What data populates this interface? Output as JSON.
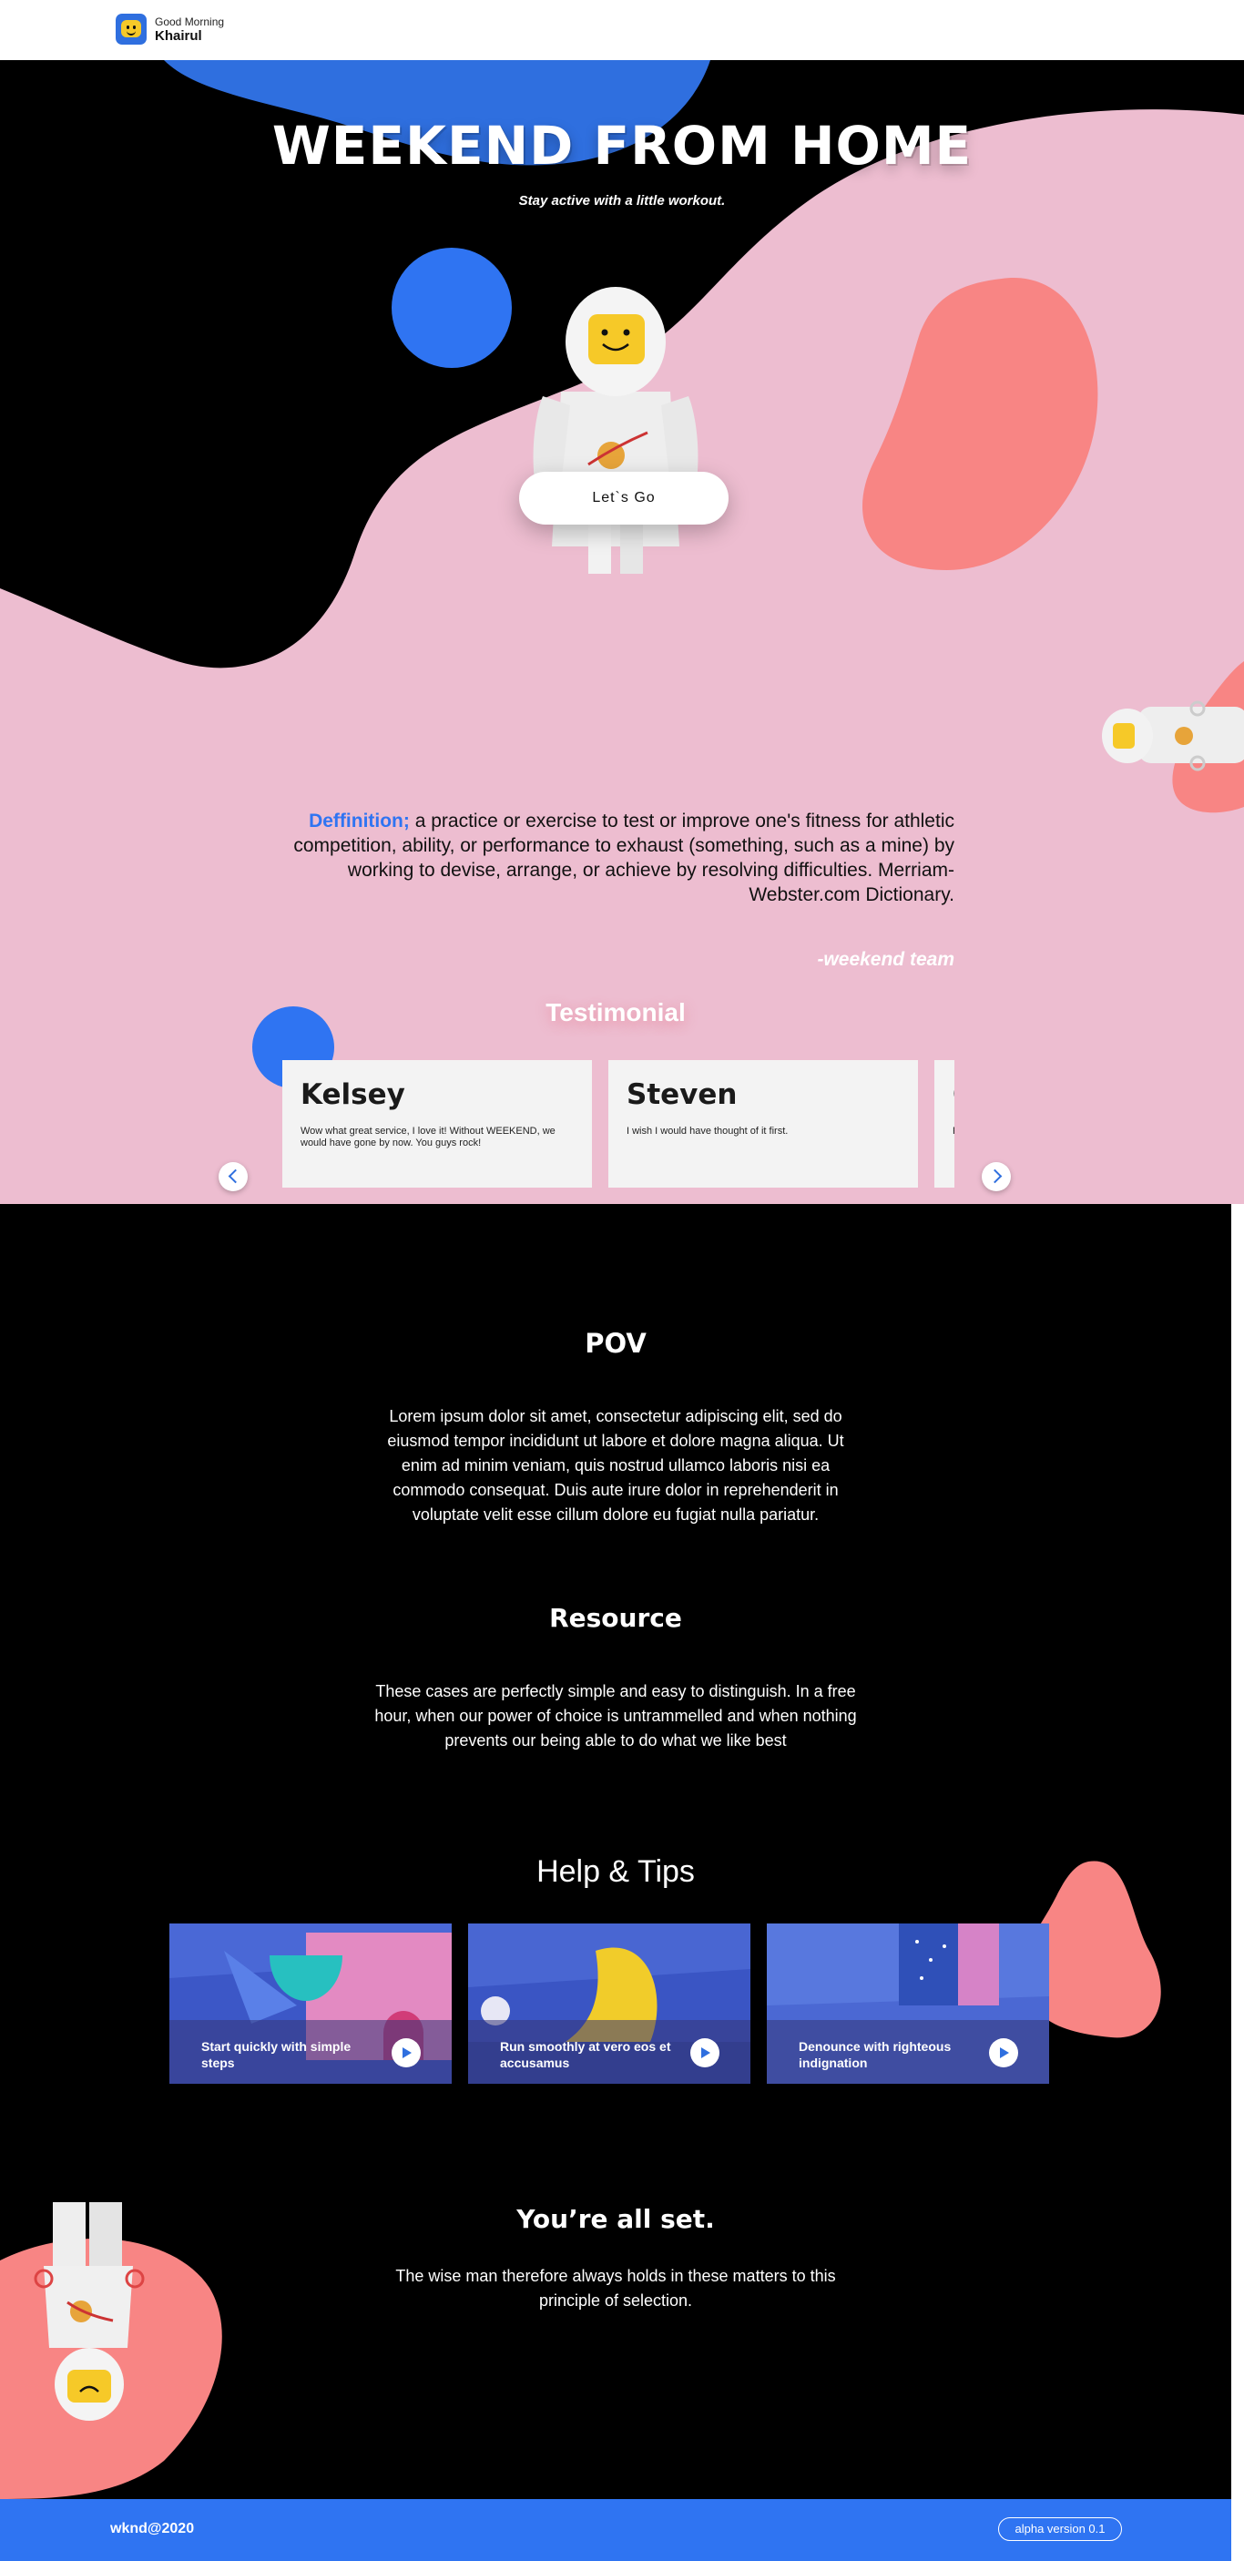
{
  "header": {
    "greeting": "Good Morning",
    "user_name": "Khairul"
  },
  "hero": {
    "title": "WEEKEND FROM HOME",
    "subtitle": "Stay active with a little workout.",
    "cta_label": "Let`s Go"
  },
  "definition": {
    "term": "Deffinition;",
    "body": " a practice or exercise to test or improve one's fitness for athletic competition, ability, or performance to exhaust (something, such as a mine) by working to devise, arrange, or achieve by resolving difficulties. Merriam-Webster.com Dictionary.",
    "signature": "-weekend team"
  },
  "testimonial": {
    "title": "Testimonial",
    "cards": [
      {
        "name": "Kelsey",
        "text": "Wow what great service, I love it! Without WEEKEND, we would have gone by now. You guys rock!"
      },
      {
        "name": "Steven",
        "text": "I wish I would have thought of it first."
      },
      {
        "name": "C",
        "text": "P"
      }
    ]
  },
  "pov": {
    "title": "POV",
    "body": "Lorem ipsum dolor sit amet, consectetur adipiscing elit, sed do eiusmod tempor incididunt ut labore et dolore magna aliqua. Ut enim ad minim veniam, quis nostrud ullamco laboris nisi ea commodo consequat. Duis aute irure dolor in reprehenderit in voluptate velit esse cillum dolore eu fugiat nulla pariatur."
  },
  "resource": {
    "title": "Resource",
    "body": "These cases are perfectly simple and easy to distinguish. In a free hour, when our power of choice is untrammelled and when nothing prevents our being able to do what we like best"
  },
  "help": {
    "title": "Help & Tips",
    "cards": [
      {
        "label": "Start quickly with simple steps"
      },
      {
        "label": "Run smoothly at vero eos et accusamus"
      },
      {
        "label": "Denounce with righteous indignation"
      }
    ]
  },
  "all_set": {
    "title": "You’re all set.",
    "body": "The wise man therefore always holds in these matters to this principle of selection."
  },
  "footer": {
    "brand": "wknd@2020",
    "version": "alpha version 0.1"
  },
  "colors": {
    "blue": "#2f74f2",
    "pink": "#edbdd0",
    "coral": "#f88584",
    "black": "#000000"
  }
}
